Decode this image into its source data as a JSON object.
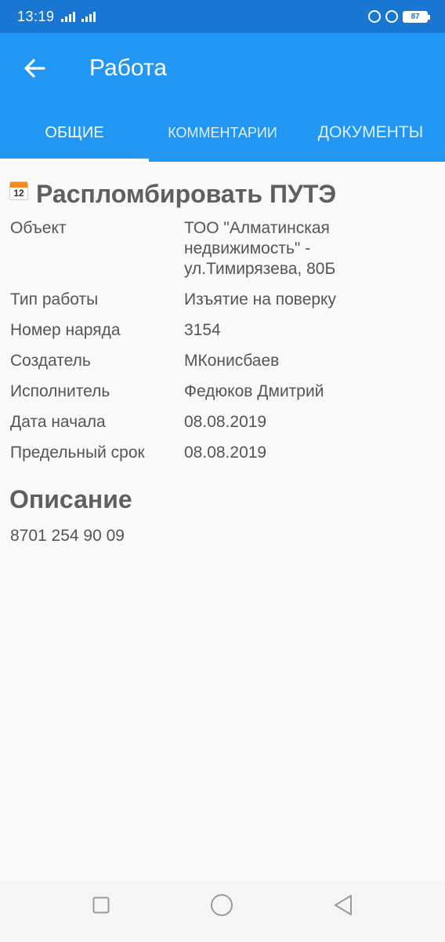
{
  "status_bar": {
    "time": "13:19",
    "battery": "87"
  },
  "app_bar": {
    "title": "Работа",
    "back_icon": "arrow-back-icon"
  },
  "tabs": [
    {
      "label": "ОБЩИЕ",
      "active": true
    },
    {
      "label": "КОММЕНТАРИИ",
      "active": false
    },
    {
      "label": "ДОКУМЕНТЫ",
      "active": false
    }
  ],
  "work": {
    "calendar_icon_number": "12",
    "title": "Распломбировать ПУТЭ",
    "fields": [
      {
        "label": "Объект",
        "value": "ТОО \"Алматинская недвижимость\" - ул.Тимирязева, 80Б"
      },
      {
        "label": "Тип работы",
        "value": "Изъятие на поверку"
      },
      {
        "label": "Номер наряда",
        "value": "3154"
      },
      {
        "label": "Создатель",
        "value": "МКонисбаев"
      },
      {
        "label": "Исполнитель",
        "value": "Федюков Дмитрий"
      },
      {
        "label": "Дата начала",
        "value": "08.08.2019"
      },
      {
        "label": "Предельный срок",
        "value": "08.08.2019"
      }
    ]
  },
  "description": {
    "title": "Описание",
    "text": "8701 254 90 09"
  },
  "colors": {
    "status_bar": "#1976d2",
    "app_bar": "#2196f3",
    "text": "#555555"
  }
}
